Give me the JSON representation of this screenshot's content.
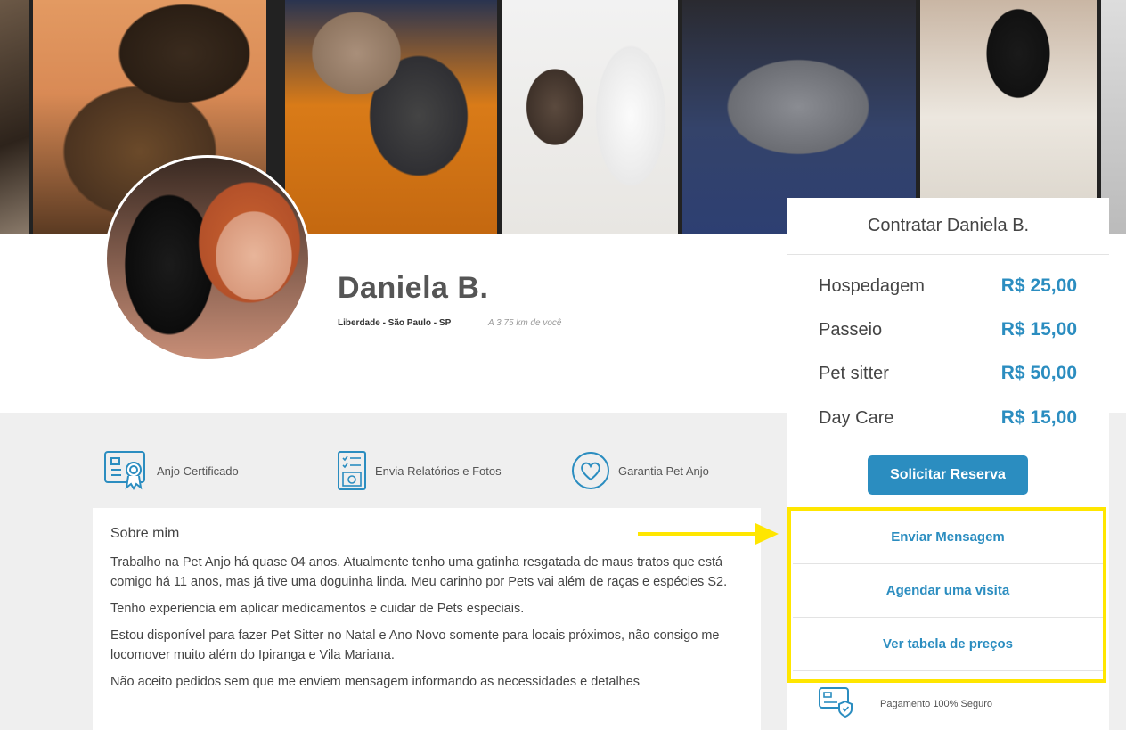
{
  "profile": {
    "name": "Daniela B.",
    "location": "Liberdade - São Paulo - SP",
    "distance": "A 3.75 km de você"
  },
  "badges": [
    {
      "label": "Anjo Certificado",
      "icon": "certificate-icon"
    },
    {
      "label": "Envia Relatórios e Fotos",
      "icon": "report-photo-icon"
    },
    {
      "label": "Garantia Pet Anjo",
      "icon": "heart-icon"
    }
  ],
  "about": {
    "title": "Sobre mim",
    "paragraphs": [
      "Trabalho na Pet Anjo há quase 04 anos. Atualmente tenho uma gatinha resgatada de maus tratos que está comigo há 11 anos, mas já tive uma doguinha linda. Meu carinho por Pets vai além de raças e espécies S2.",
      "Tenho experiencia em aplicar medicamentos e cuidar de Pets especiais.",
      "Estou disponível para fazer Pet Sitter no Natal e Ano Novo somente para locais próximos, não consigo me locomover muito além do Ipiranga e Vila Mariana.",
      "Não aceito pedidos sem que me enviem mensagem informando as necessidades e detalhes"
    ]
  },
  "booking": {
    "title": "Contratar Daniela B.",
    "prices": [
      {
        "label": "Hospedagem",
        "value": "R$ 25,00"
      },
      {
        "label": "Passeio",
        "value": "R$ 15,00"
      },
      {
        "label": "Pet sitter",
        "value": "R$ 50,00"
      },
      {
        "label": "Day Care",
        "value": "R$ 15,00"
      }
    ],
    "reserve_label": "Solicitar Reserva",
    "actions": [
      {
        "label": "Enviar Mensagem"
      },
      {
        "label": "Agendar uma visita"
      },
      {
        "label": "Ver tabela de preços"
      }
    ],
    "secure_label": "Pagamento 100% Seguro"
  },
  "colors": {
    "accent": "#2b8dc0",
    "highlight": "#ffe600"
  }
}
